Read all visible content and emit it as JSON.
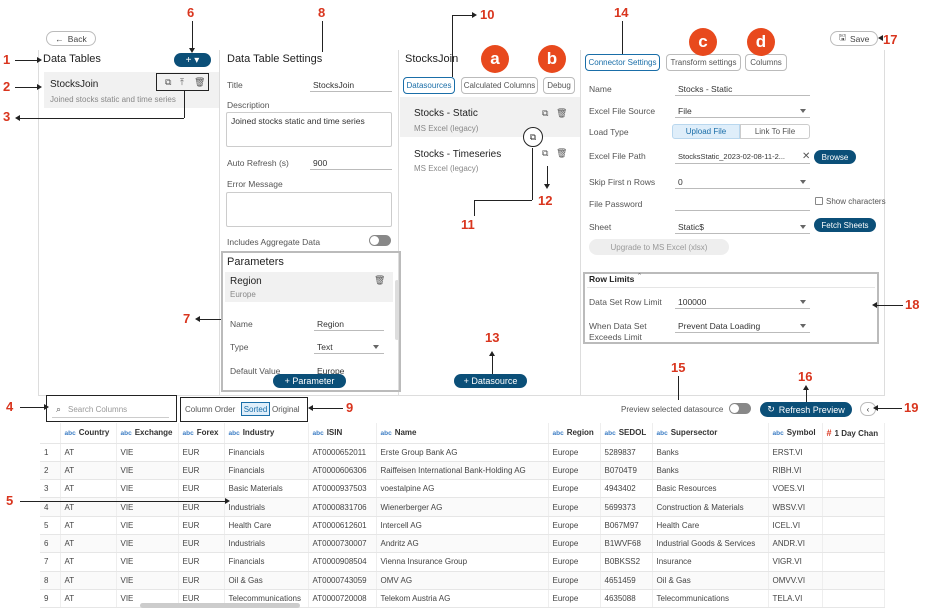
{
  "toolbar": {
    "back_label": "Back",
    "save_label": "Save"
  },
  "data_tables": {
    "title": "Data Tables",
    "add_label": "+ ▾",
    "item": {
      "name": "StocksJoin",
      "desc": "Joined stocks static and time series"
    }
  },
  "settings": {
    "title": "Data Table Settings",
    "title_label": "Title",
    "title_value": "StocksJoin",
    "desc_label": "Description",
    "desc_value": "Joined stocks static and time series",
    "refresh_label": "Auto Refresh (s)",
    "refresh_value": "900",
    "error_label": "Error Message",
    "aggregate_label": "Includes Aggregate Data",
    "params_title": "Parameters",
    "param": {
      "name": "Region",
      "value": "Europe"
    },
    "fields": [
      {
        "label": "Name",
        "value": "Region"
      },
      {
        "label": "Type",
        "value": "Text"
      },
      {
        "label": "Default Value",
        "value": "Europe"
      }
    ],
    "add_param_label": "+ Parameter"
  },
  "datasources": {
    "header": "StocksJoin",
    "tabs": [
      "Datasources",
      "Calculated Columns",
      "Debug"
    ],
    "items": [
      {
        "name": "Stocks - Static",
        "type": "MS Excel (legacy)"
      },
      {
        "name": "Stocks - Timeseries",
        "type": "MS Excel (legacy)"
      }
    ],
    "add_label": "+ Datasource"
  },
  "connector": {
    "tabs": [
      "Connector Settings",
      "Transform settings",
      "Columns"
    ],
    "name_label": "Name",
    "name_value": "Stocks - Static",
    "source_label": "Excel File Source",
    "source_value": "File",
    "load_label": "Load Type",
    "upload_label": "Upload File",
    "link_label": "Link To File",
    "path_label": "Excel File Path",
    "path_value": "StocksStatic_2023-02-08-11-2...",
    "browse_label": "Browse",
    "skip_label": "Skip First n Rows",
    "skip_value": "0",
    "password_label": "File Password",
    "show_chars_label": "Show characters",
    "sheet_label": "Sheet",
    "sheet_value": "Static$",
    "fetch_label": "Fetch Sheets",
    "upgrade_label": "Upgrade to MS Excel (xlsx)",
    "row_limits_title": "Row Limits",
    "row_limit_label": "Data Set Row Limit",
    "row_limit_value": "100000",
    "exceed_label_1": "When Data Set",
    "exceed_label_2": "Exceeds Limit",
    "exceed_value": "Prevent Data Loading"
  },
  "preview": {
    "search_placeholder": "Search Columns",
    "column_order_label": "Column Order",
    "sorted_label": "Sorted",
    "original_label": "Original",
    "preview_label": "Preview selected datasource",
    "refresh_label": "Refresh Preview"
  },
  "grid": {
    "columns": [
      {
        "type": "",
        "name": ""
      },
      {
        "type": "abc",
        "name": "Country"
      },
      {
        "type": "abc",
        "name": "Exchange"
      },
      {
        "type": "abc",
        "name": "Forex"
      },
      {
        "type": "abc",
        "name": "Industry"
      },
      {
        "type": "abc",
        "name": "ISIN"
      },
      {
        "type": "abc",
        "name": "Name"
      },
      {
        "type": "abc",
        "name": "Region"
      },
      {
        "type": "abc",
        "name": "SEDOL"
      },
      {
        "type": "abc",
        "name": "Supersector"
      },
      {
        "type": "abc",
        "name": "Symbol"
      },
      {
        "type": "#",
        "name": "1 Day Chan"
      }
    ],
    "rows": [
      [
        "1",
        "AT",
        "VIE",
        "EUR",
        "Financials",
        "AT0000652011",
        "Erste Group Bank AG",
        "Europe",
        "5289837",
        "Banks",
        "ERST.VI",
        ""
      ],
      [
        "2",
        "AT",
        "VIE",
        "EUR",
        "Financials",
        "AT0000606306",
        "Raiffeisen International Bank-Holding AG",
        "Europe",
        "B0704T9",
        "Banks",
        "RIBH.VI",
        ""
      ],
      [
        "3",
        "AT",
        "VIE",
        "EUR",
        "Basic Materials",
        "AT0000937503",
        "voestalpine AG",
        "Europe",
        "4943402",
        "Basic Resources",
        "VOES.VI",
        ""
      ],
      [
        "4",
        "AT",
        "VIE",
        "EUR",
        "Industrials",
        "AT0000831706",
        "Wienerberger AG",
        "Europe",
        "5699373",
        "Construction & Materials",
        "WBSV.VI",
        ""
      ],
      [
        "5",
        "AT",
        "VIE",
        "EUR",
        "Health Care",
        "AT0000612601",
        "Intercell AG",
        "Europe",
        "B067M97",
        "Health Care",
        "ICEL.VI",
        ""
      ],
      [
        "6",
        "AT",
        "VIE",
        "EUR",
        "Industrials",
        "AT0000730007",
        "Andritz AG",
        "Europe",
        "B1WVF68",
        "Industrial Goods & Services",
        "ANDR.VI",
        ""
      ],
      [
        "7",
        "AT",
        "VIE",
        "EUR",
        "Financials",
        "AT0000908504",
        "Vienna Insurance Group",
        "Europe",
        "B0BKSS2",
        "Insurance",
        "VIGR.VI",
        ""
      ],
      [
        "8",
        "AT",
        "VIE",
        "EUR",
        "Oil & Gas",
        "AT0000743059",
        "OMV AG",
        "Europe",
        "4651459",
        "Oil & Gas",
        "OMVV.VI",
        ""
      ],
      [
        "9",
        "AT",
        "VIE",
        "EUR",
        "Telecommunications",
        "AT0000720008",
        "Telekom Austria AG",
        "Europe",
        "4635088",
        "Telecommunications",
        "TELA.VI",
        ""
      ]
    ]
  },
  "annotations": {
    "n1": "1",
    "n2": "2",
    "n3": "3",
    "n4": "4",
    "n5": "5",
    "n6": "6",
    "n7": "7",
    "n8": "8",
    "n9": "9",
    "n10": "10",
    "n11": "11",
    "n12": "12",
    "n13": "13",
    "n14": "14",
    "n15": "15",
    "n16": "16",
    "n17": "17",
    "n18": "18",
    "n19": "19",
    "a": "a",
    "b": "b",
    "c": "c",
    "d": "d"
  }
}
